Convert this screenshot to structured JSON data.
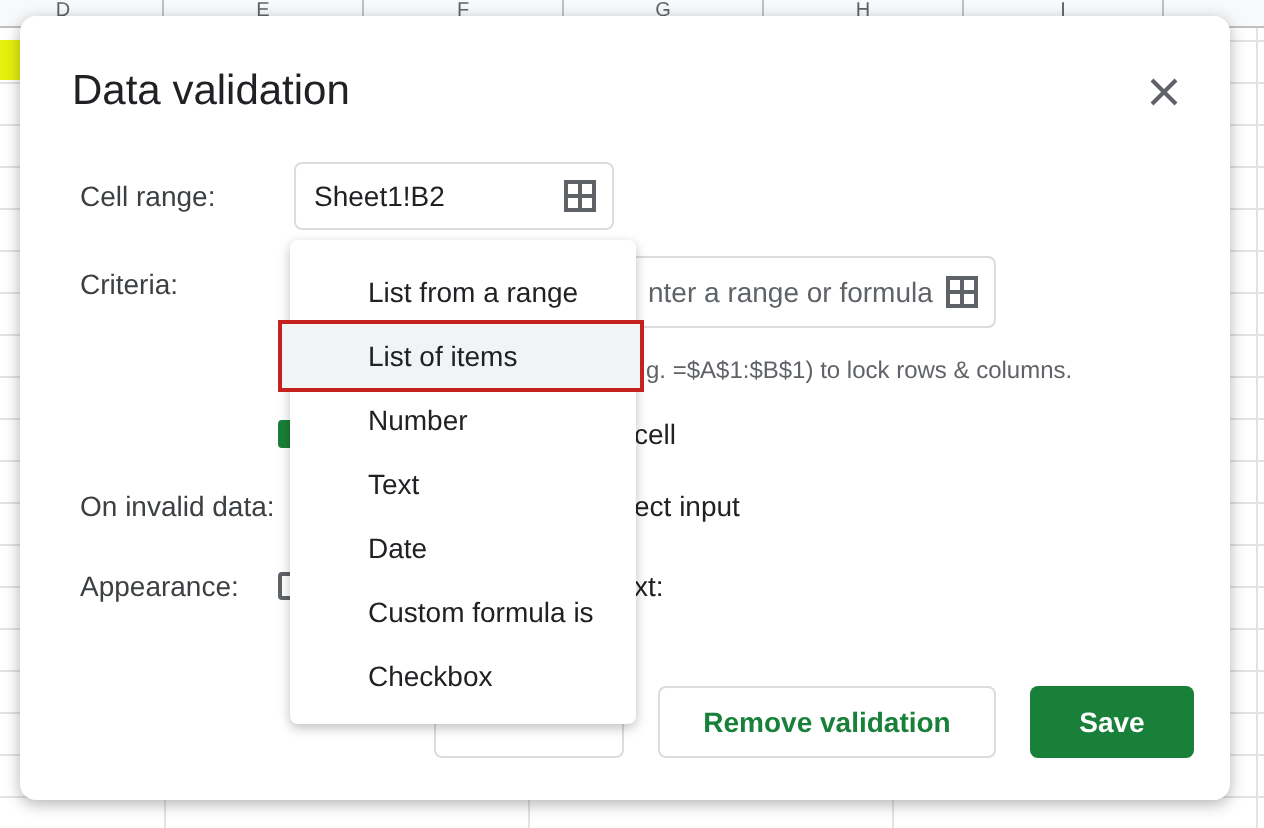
{
  "sheet": {
    "column_headers": [
      "D",
      "E",
      "F",
      "G",
      "H",
      "I"
    ]
  },
  "dialog": {
    "title": "Data validation",
    "cell_range": {
      "label": "Cell range:",
      "value": "Sheet1!B2"
    },
    "criteria": {
      "label": "Criteria:",
      "range_placeholder": "nter a range or formula",
      "hint": "g. =$A$1:$B$1) to lock rows & columns.",
      "show_dropdown": {
        "label": "cell",
        "checked": true
      }
    },
    "on_invalid_data": {
      "label": "On invalid data:",
      "option": "ect input"
    },
    "appearance": {
      "label": "Appearance:",
      "checked": false,
      "option": "xt:"
    },
    "buttons": [
      {
        "label": "Remove validation",
        "kind": "outlined"
      },
      {
        "label": "Save",
        "kind": "primary"
      }
    ]
  },
  "criteria_menu": {
    "items": [
      {
        "label": "List from a range",
        "selected": false
      },
      {
        "label": "List of items",
        "selected": true
      },
      {
        "label": "Number",
        "selected": false
      },
      {
        "label": "Text",
        "selected": false
      },
      {
        "label": "Date",
        "selected": false
      },
      {
        "label": "Custom formula is",
        "selected": false
      },
      {
        "label": "Checkbox",
        "selected": false
      }
    ]
  }
}
